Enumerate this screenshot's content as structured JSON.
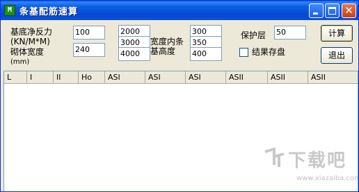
{
  "window": {
    "title": "条基配筋速算",
    "app_icon_glyph": "M"
  },
  "form": {
    "base_reaction_label_1": "基底净反力",
    "base_reaction_label_2": "(KN/M*M)",
    "base_reaction_value": "100",
    "masonry_width_label": "砌体宽度",
    "masonry_width_unit": "(mm)",
    "masonry_width_value": "240",
    "width_values": [
      "2000",
      "3000",
      "4000"
    ],
    "width_label_1": "宽度内条",
    "width_label_2": "基高度",
    "height_values": [
      "300",
      "350",
      "400"
    ],
    "cover_label": "保护层",
    "cover_value": "50",
    "save_result_label": "结果存盘",
    "save_result_checked": false
  },
  "buttons": {
    "calculate": "计算",
    "exit": "退出"
  },
  "table": {
    "columns": [
      "L",
      "I",
      "II",
      "Ho",
      "ASI",
      "ASI",
      "ASI",
      "ASII",
      "ASII",
      "ASII"
    ],
    "rows": []
  },
  "watermark": {
    "brand": "下载吧",
    "url": "www.xiazaiba.com"
  }
}
